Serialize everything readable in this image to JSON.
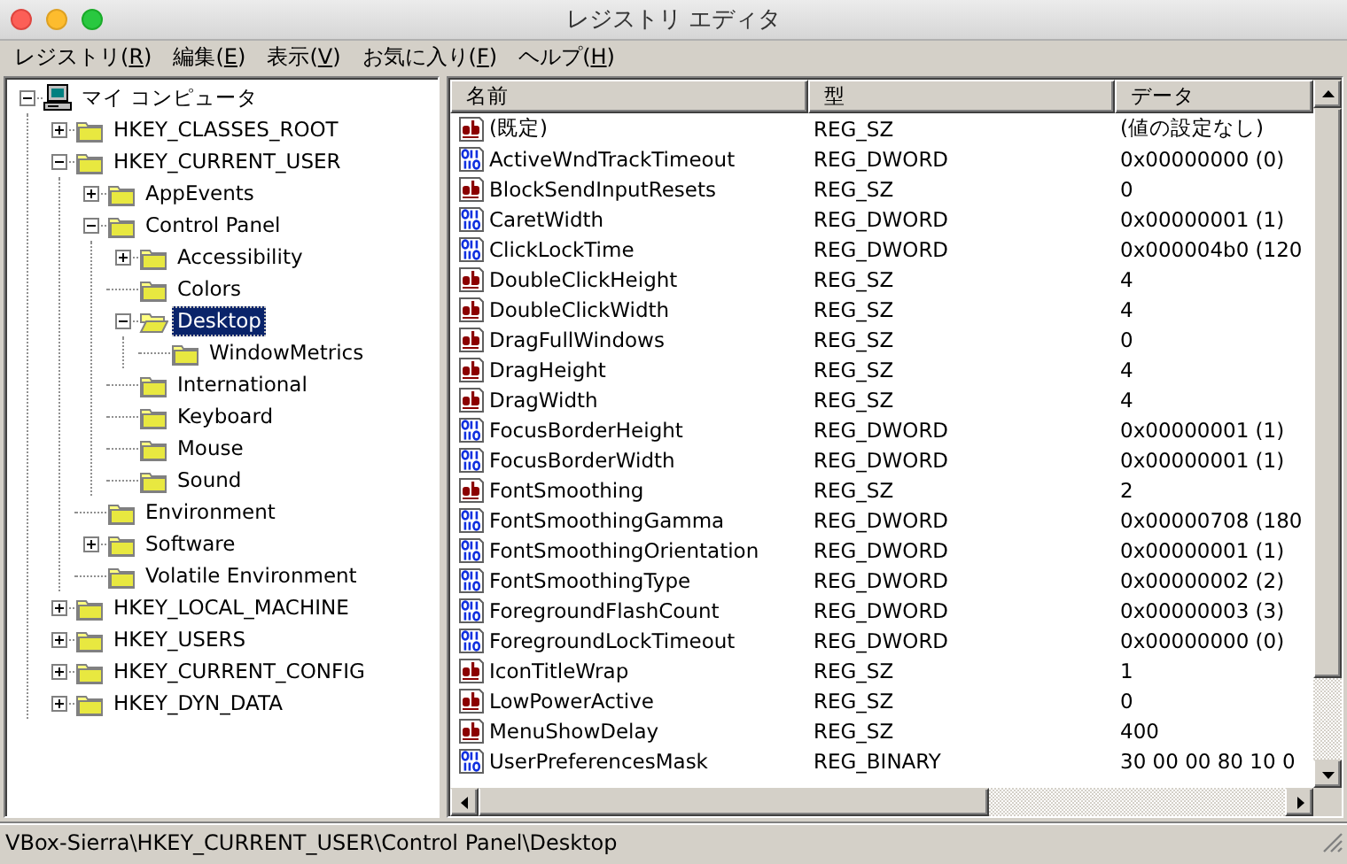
{
  "window": {
    "title": "レジストリ エディタ"
  },
  "menu": [
    {
      "label": "レジストリ(",
      "access_key": "R",
      "label_end": ")"
    },
    {
      "label": "編集(",
      "access_key": "E",
      "label_end": ")"
    },
    {
      "label": "表示(",
      "access_key": "V",
      "label_end": ")"
    },
    {
      "label": "お気に入り(",
      "access_key": "F",
      "label_end": ")"
    },
    {
      "label": "ヘルプ(",
      "access_key": "H",
      "label_end": ")"
    }
  ],
  "tree": {
    "label": "マイ コンピュータ",
    "kind": "computer",
    "expanded": true,
    "selected": false,
    "children": [
      {
        "label": "HKEY_CLASSES_ROOT",
        "kind": "folder",
        "expanded": false,
        "selected": false
      },
      {
        "label": "HKEY_CURRENT_USER",
        "kind": "folder",
        "expanded": true,
        "selected": false,
        "children": [
          {
            "label": "AppEvents",
            "kind": "folder",
            "expanded": false,
            "selected": false
          },
          {
            "label": "Control Panel",
            "kind": "folder",
            "expanded": true,
            "selected": false,
            "children": [
              {
                "label": "Accessibility",
                "kind": "folder",
                "expanded": false,
                "selected": false
              },
              {
                "label": "Colors",
                "kind": "folder",
                "selected": false
              },
              {
                "label": "Desktop",
                "kind": "folder",
                "expanded": true,
                "selected": true,
                "children": [
                  {
                    "label": "WindowMetrics",
                    "kind": "folder",
                    "selected": false
                  }
                ]
              },
              {
                "label": "International",
                "kind": "folder",
                "selected": false
              },
              {
                "label": "Keyboard",
                "kind": "folder",
                "selected": false
              },
              {
                "label": "Mouse",
                "kind": "folder",
                "selected": false
              },
              {
                "label": "Sound",
                "kind": "folder",
                "selected": false
              }
            ]
          },
          {
            "label": "Environment",
            "kind": "folder",
            "selected": false
          },
          {
            "label": "Software",
            "kind": "folder",
            "expanded": false,
            "selected": false
          },
          {
            "label": "Volatile Environment",
            "kind": "folder",
            "selected": false
          }
        ]
      },
      {
        "label": "HKEY_LOCAL_MACHINE",
        "kind": "folder",
        "expanded": false,
        "selected": false
      },
      {
        "label": "HKEY_USERS",
        "kind": "folder",
        "expanded": false,
        "selected": false
      },
      {
        "label": "HKEY_CURRENT_CONFIG",
        "kind": "folder",
        "expanded": false,
        "selected": false
      },
      {
        "label": "HKEY_DYN_DATA",
        "kind": "folder",
        "expanded": false,
        "selected": false
      }
    ]
  },
  "table": {
    "columns": [
      "名前",
      "型",
      "データ"
    ],
    "rows": [
      {
        "kind": "string",
        "name": "(既定)",
        "type": "REG_SZ",
        "data": "(値の設定なし)"
      },
      {
        "kind": "binary",
        "name": "ActiveWndTrackTimeout",
        "type": "REG_DWORD",
        "data": "0x00000000 (0)"
      },
      {
        "kind": "string",
        "name": "BlockSendInputResets",
        "type": "REG_SZ",
        "data": "0"
      },
      {
        "kind": "binary",
        "name": "CaretWidth",
        "type": "REG_DWORD",
        "data": "0x00000001 (1)"
      },
      {
        "kind": "binary",
        "name": "ClickLockTime",
        "type": "REG_DWORD",
        "data": "0x000004b0 (120"
      },
      {
        "kind": "string",
        "name": "DoubleClickHeight",
        "type": "REG_SZ",
        "data": "4"
      },
      {
        "kind": "string",
        "name": "DoubleClickWidth",
        "type": "REG_SZ",
        "data": "4"
      },
      {
        "kind": "string",
        "name": "DragFullWindows",
        "type": "REG_SZ",
        "data": "0"
      },
      {
        "kind": "string",
        "name": "DragHeight",
        "type": "REG_SZ",
        "data": "4"
      },
      {
        "kind": "string",
        "name": "DragWidth",
        "type": "REG_SZ",
        "data": "4"
      },
      {
        "kind": "binary",
        "name": "FocusBorderHeight",
        "type": "REG_DWORD",
        "data": "0x00000001 (1)"
      },
      {
        "kind": "binary",
        "name": "FocusBorderWidth",
        "type": "REG_DWORD",
        "data": "0x00000001 (1)"
      },
      {
        "kind": "string",
        "name": "FontSmoothing",
        "type": "REG_SZ",
        "data": "2"
      },
      {
        "kind": "binary",
        "name": "FontSmoothingGamma",
        "type": "REG_DWORD",
        "data": "0x00000708 (180"
      },
      {
        "kind": "binary",
        "name": "FontSmoothingOrientation",
        "type": "REG_DWORD",
        "data": "0x00000001 (1)"
      },
      {
        "kind": "binary",
        "name": "FontSmoothingType",
        "type": "REG_DWORD",
        "data": "0x00000002 (2)"
      },
      {
        "kind": "binary",
        "name": "ForegroundFlashCount",
        "type": "REG_DWORD",
        "data": "0x00000003 (3)"
      },
      {
        "kind": "binary",
        "name": "ForegroundLockTimeout",
        "type": "REG_DWORD",
        "data": "0x00000000 (0)"
      },
      {
        "kind": "string",
        "name": "IconTitleWrap",
        "type": "REG_SZ",
        "data": "1"
      },
      {
        "kind": "string",
        "name": "LowPowerActive",
        "type": "REG_SZ",
        "data": "0"
      },
      {
        "kind": "string",
        "name": "MenuShowDelay",
        "type": "REG_SZ",
        "data": "400"
      },
      {
        "kind": "binary",
        "name": "UserPreferencesMask",
        "type": "REG_BINARY",
        "data": "30 00 00 80 10 0"
      }
    ]
  },
  "status_bar": "VBox-Sierra\\HKEY_CURRENT_USER\\Control Panel\\Desktop"
}
